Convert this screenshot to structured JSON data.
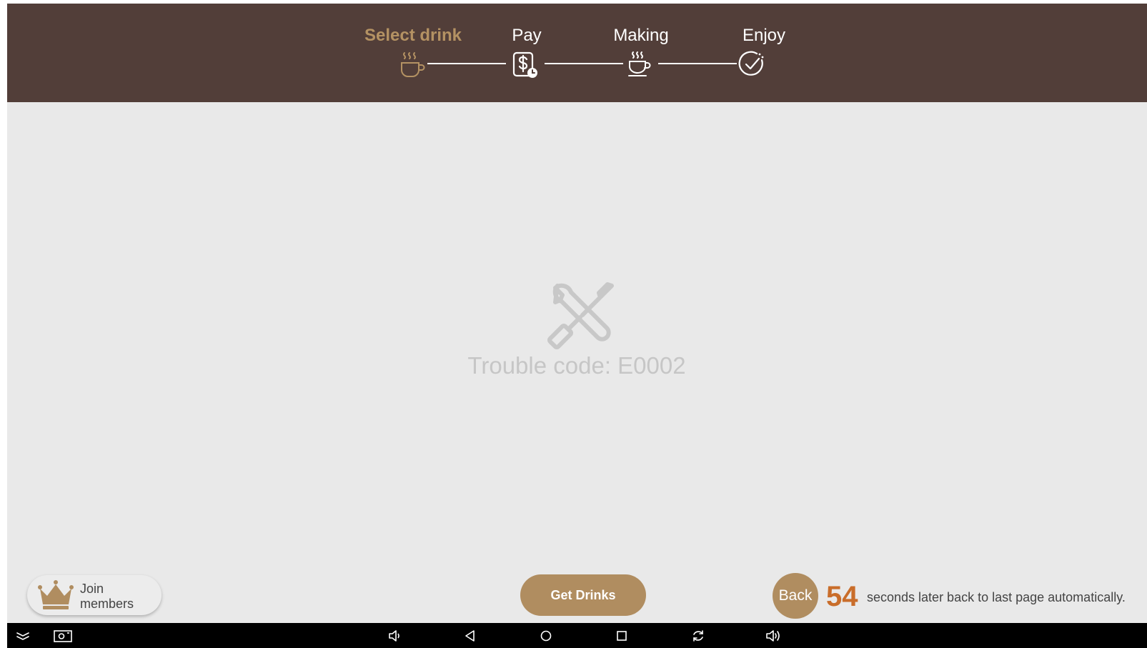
{
  "colors": {
    "header_bg": "#523e39",
    "accent": "#b08d60",
    "active_step": "#b49263",
    "countdown": "#c96d2a",
    "screen_bg": "#e9e9e9"
  },
  "steps": [
    {
      "label": "Select drink",
      "icon": "steaming-cup-icon",
      "active": true
    },
    {
      "label": "Pay",
      "icon": "pay-bill-icon",
      "active": false
    },
    {
      "label": "Making",
      "icon": "coffee-cup-icon",
      "active": false
    },
    {
      "label": "Enjoy",
      "icon": "check-circle-icon",
      "active": false
    }
  ],
  "trouble": {
    "icon": "tools-icon",
    "text": "Trouble code: E0002"
  },
  "bottom": {
    "join": {
      "icon": "crown-icon",
      "label_line1": "Join",
      "label_line2": "members"
    },
    "get_drinks": "Get Drinks",
    "back": "Back",
    "countdown": "54",
    "countdown_text": "seconds later back to last page automatically."
  },
  "navbar": {
    "icons": [
      "collapse-icon",
      "screenshot-icon",
      "volume-down-icon",
      "nav-back-icon",
      "nav-home-icon",
      "nav-recents-icon",
      "rotate-icon",
      "volume-up-icon"
    ]
  }
}
